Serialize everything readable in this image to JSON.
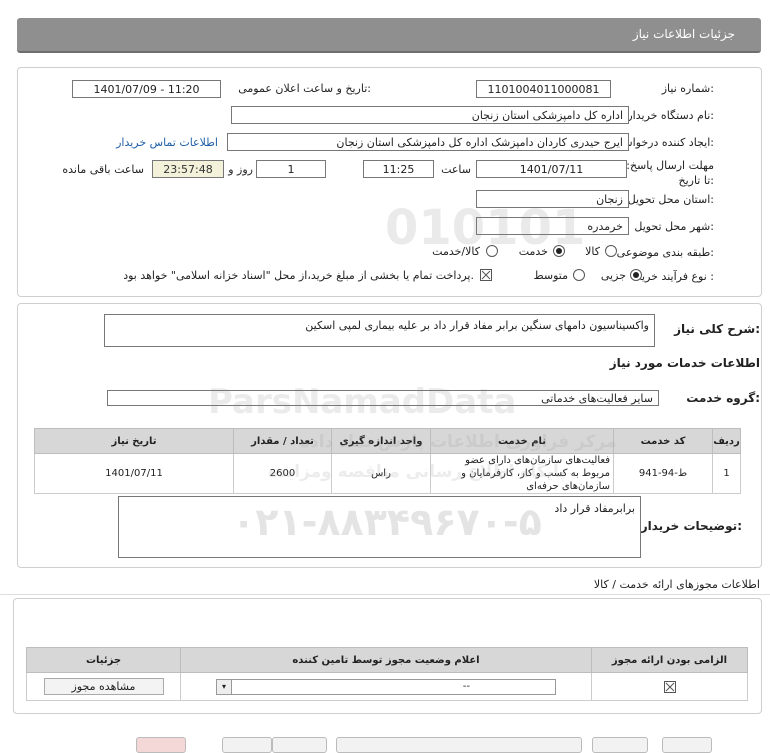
{
  "header": {
    "title": "جزئیات اطلاعات نیاز"
  },
  "form": {
    "need_number_label": "شماره نیاز:",
    "need_number": "1101004011000081",
    "announce_label": "تاریخ و ساعت اعلان عمومی:",
    "announce_value": "1401/07/09 - 11:20",
    "buyer_org_label": "نام دستگاه خریدار:",
    "buyer_org": "اداره کل دامپزشکی استان زنجان",
    "requester_label": "ایجاد کننده درخواست:",
    "requester": "ایرج  حیدری کاردان دامپزشک اداره کل دامپزشکی استان زنجان",
    "contact_link": "اطلاعات تماس خریدار",
    "deadline_label": "مهلت ارسال پاسخ: تا تاریخ:",
    "deadline_date": "1401/07/11",
    "time_label": "ساعت",
    "deadline_time": "11:25",
    "day_count": "1",
    "day_label": "روز و",
    "remaining_time": "23:57:48",
    "remaining_label": "ساعت باقی مانده",
    "province_label": "استان محل تحویل:",
    "province": "زنجان",
    "city_label": "شهر محل تحویل:",
    "city": "خرمدره",
    "category_label": "طبقه بندی موضوعی:",
    "category_options": [
      "کالا",
      "خدمت",
      "کالا/خدمت"
    ],
    "category_selected": "خدمت",
    "process_label": "نوع فرآیند خرید :",
    "process_options": [
      "جزیی",
      "متوسط"
    ],
    "process_selected": "جزیی",
    "payment_note": "پرداخت تمام یا بخشی از مبلغ خرید،از محل \"اسناد خزانه اسلامی\" خواهد بود."
  },
  "summary": {
    "label": "شرح کلی نیاز:",
    "value": "واکسیناسیون دامهای سنگین برابر مفاد قرار داد بر علیه بیماری لمپی اسکین",
    "services_title": "اطلاعات خدمات مورد نیاز",
    "group_label": "گروه خدمت:",
    "group_value": "سایر فعالیت‌های خدماتی"
  },
  "services_table": {
    "headers": [
      "ردیف",
      "کد خدمت",
      "نام خدمت",
      "واحد اندازه گیری",
      "تعداد / مقدار",
      "تاریخ نیاز"
    ],
    "rows": [
      {
        "row": "1",
        "code": "ط-94-941",
        "name": "فعالیت‌های سازمان‌های دارای عضو مربوط به کسب و کار، کارفرمایان و سازمان‌های حرفه‌ای",
        "unit": "راس",
        "qty": "2600",
        "date": "1401/07/11"
      }
    ]
  },
  "buyer_notes": {
    "label": "توضیحات خریدار:",
    "value": "برابرمفاد قرار داد"
  },
  "permits": {
    "title": "اطلاعات مجوزهای ارائه خدمت / کالا",
    "headers": [
      "الزامی بودن ارائه مجوز",
      "اعلام وضعیت مجوز توسط تامین کننده",
      "جزئیات"
    ],
    "select_value": "--",
    "view_button": "مشاهده مجوز"
  },
  "watermark": {
    "number": "010101",
    "brand": "ParsNamadData",
    "fa_line1": "مرکز فراوری اطلاعات پارس نماد داده",
    "fa_line2": "پایگاه اطلاع رسانی مناقصه ومزایده",
    "phone": "۰۲۱-۸۸۳۴۹۶۷۰-۵"
  },
  "colors": {
    "header_bg": "#8f8f8f",
    "link": "#1f5fa8",
    "remaining_bg": "#f3f1d9"
  }
}
